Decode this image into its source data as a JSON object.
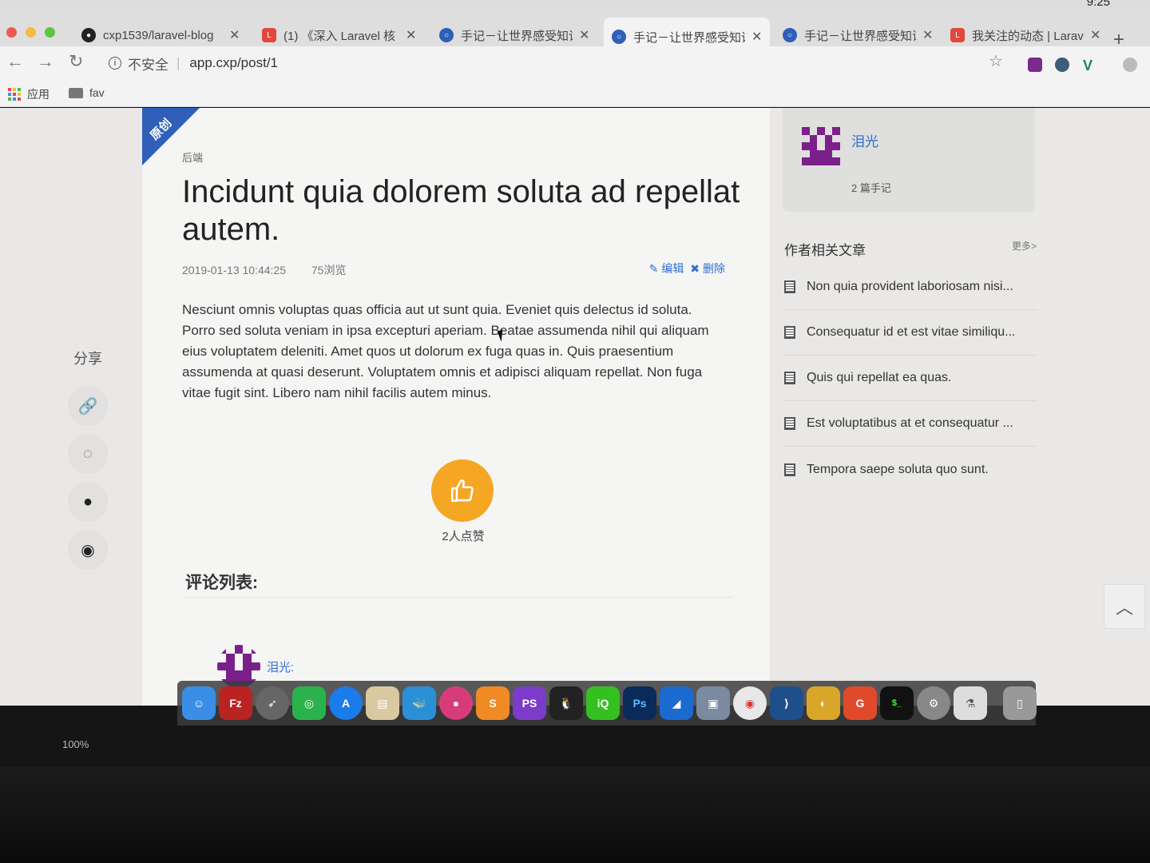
{
  "system": {
    "clock": "9:25"
  },
  "tabs": [
    {
      "title": "cxp1539/laravel-blog",
      "icon": "github-icon",
      "color": "#222222"
    },
    {
      "title": "(1) 《深入 Laravel 核",
      "icon": "laravel-icon",
      "color": "#e0483d"
    },
    {
      "title": "手记－让世界感受知识",
      "icon": "blog-icon",
      "color": "#2f5fb8"
    },
    {
      "title": "手记－让世界感受知识",
      "icon": "blog-icon",
      "color": "#2f5fb8"
    },
    {
      "title": "手记－让世界感受知识",
      "icon": "blog-icon",
      "color": "#2f5fb8"
    },
    {
      "title": "我关注的动态 | Larave",
      "icon": "laravel-icon",
      "color": "#e0483d"
    }
  ],
  "addressbar": {
    "security": "不安全",
    "url": "app.cxp/post/1"
  },
  "bookmarks": {
    "apps": "应用",
    "fav": "fav"
  },
  "share": {
    "title": "分享"
  },
  "article": {
    "ribbon": "原创",
    "category": "后端",
    "title": "Incidunt quia dolorem soluta ad repellat autem.",
    "date": "2019-01-13 10:44:25",
    "views": "75浏览",
    "edit": "编辑",
    "delete": "删除",
    "body": "Nesciunt omnis voluptas quas officia aut ut sunt quia. Eveniet quis delectus id soluta. Porro sed soluta veniam in ipsa excepturi aperiam. Beatae assumenda nihil qui aliquam eius voluptatem deleniti. Amet quos ut dolorum ex fuga quas in. Quis praesentium assumenda at quasi deserunt. Voluptatem omnis et adipisci aliquam repellat. Non fuga vitae fugit sint. Libero nam nihil facilis autem minus.",
    "likes": "2人点赞",
    "comments_title": "评论列表:",
    "comment_author": "泪光:"
  },
  "author": {
    "name": "泪光",
    "posts": "2 篇手记"
  },
  "related": {
    "title": "作者相关文章",
    "more": "更多>",
    "items": [
      "Non quia provident laboriosam nisi...",
      "Consequatur id et est vitae similiqu...",
      "Quis qui repellat ea quas.",
      "Est voluptatibus at et consequatur ...",
      "Tempora saepe soluta quo sunt."
    ]
  },
  "status": {
    "zoom": "100%"
  },
  "colors": {
    "accent": "#2f6fd0",
    "like": "#f5a623",
    "ribbon": "#2f5fb8",
    "avatar": "#7b1f8a"
  }
}
